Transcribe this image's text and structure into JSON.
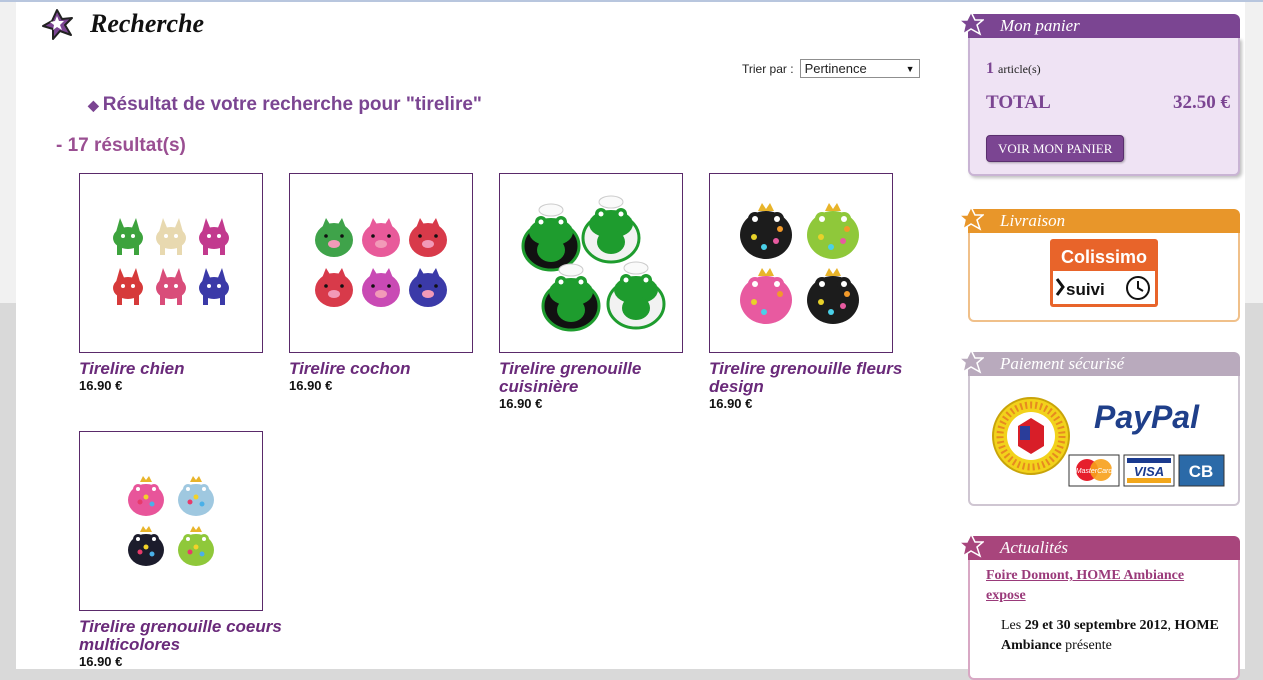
{
  "header": {
    "title": "Recherche"
  },
  "sort": {
    "label": "Trier par :",
    "selected": "Pertinence"
  },
  "results": {
    "heading": "Résultat de votre recherche pour \"tirelire\"",
    "count": "- 17 résultat(s)"
  },
  "products": [
    {
      "name": "Tirelire chien",
      "price": "16.90 €",
      "colors": [
        "#3da33d",
        "#e8d9b0",
        "#c23a8e",
        "#d63a3a",
        "#d94d7a",
        "#3b3aa8"
      ]
    },
    {
      "name": "Tirelire cochon",
      "price": "16.90 €",
      "colors": [
        "#3fa34a",
        "#e85a9a",
        "#d83a4a",
        "#d83a4a",
        "#c94ab4",
        "#3b3aa8"
      ]
    },
    {
      "name": "Tirelire grenouille cuisinière",
      "price": "16.90 €",
      "colors": [
        "#1e9c2e",
        "#1e9c2e",
        "#1e9c2e",
        "#1e9c2e"
      ]
    },
    {
      "name": "Tirelire grenouille fleurs design",
      "price": "16.90 €",
      "colors": [
        "#1c1c1c",
        "#8fc83a",
        "#e85aa0",
        "#1c1c1c"
      ]
    },
    {
      "name": "Tirelire grenouille coeurs multicolores",
      "price": "16.90 €",
      "colors": [
        "#e8559a",
        "#9fc8e0",
        "#1c1c2c",
        "#8fc83a"
      ]
    }
  ],
  "cart": {
    "title": "Mon panier",
    "count": "1",
    "count_label": "article(s)",
    "total_label": "TOTAL",
    "total_value": "32.50 €",
    "button": "VOIR MON PANIER"
  },
  "delivery": {
    "title": "Livraison",
    "logo_top": "Colissimo",
    "logo_bottom": "suivi"
  },
  "payment": {
    "title": "Paiement sécurisé",
    "paypal": "PayPal",
    "cards": [
      "MasterCard",
      "VISA",
      "CB"
    ]
  },
  "news": {
    "title": "Actualités",
    "link": "Foire Domont, HOME Ambiance expose",
    "text_pre": "Les ",
    "text_dates": "29 et 30 septembre 2012",
    "text_mid": ", ",
    "text_company": "HOME Ambiance",
    "text_post": " présente"
  },
  "theme": {
    "purple": "#7b4592",
    "cart_bg": "#efe3f4",
    "orange": "#e8962a",
    "gray": "#b9aabd",
    "pink": "#a8457c"
  }
}
